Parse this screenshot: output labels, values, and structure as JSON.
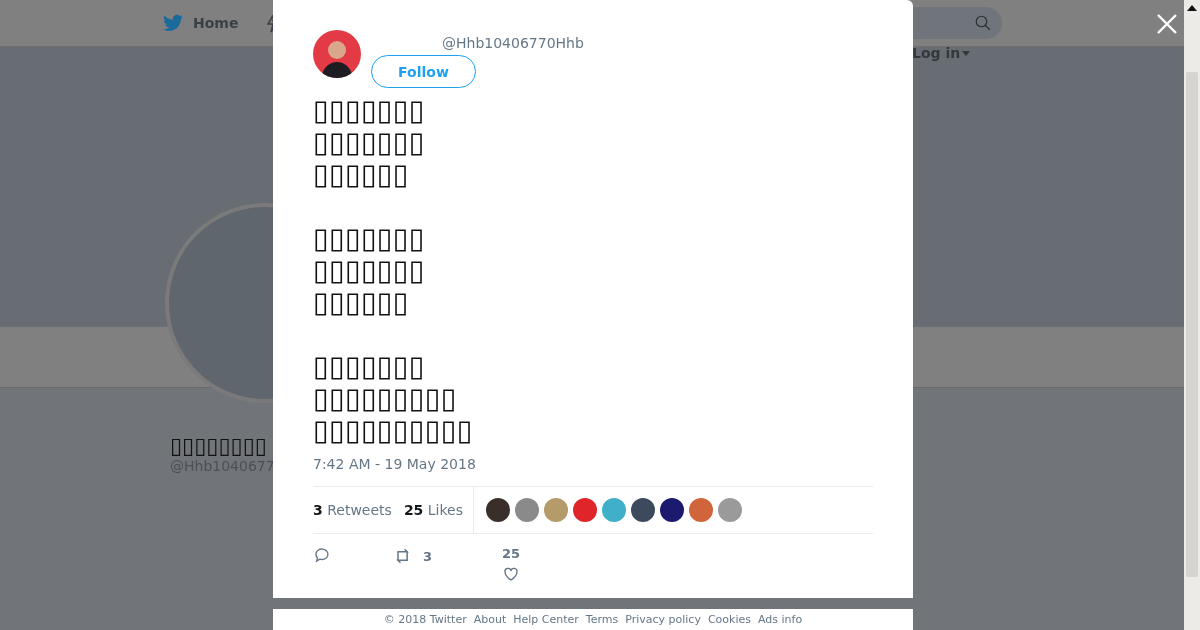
{
  "nav": {
    "home": "Home",
    "login": "Log in"
  },
  "profile": {
    "name": "▯▯▯▯▯▯▯▯",
    "handle": "@Hhb1040677"
  },
  "tweet": {
    "handle": "@Hhb10406770Hhb",
    "follow": "Follow",
    "paragraphs": [
      [
        "▯▯▯▯▯▯▯",
        "▯▯▯▯▯▯▯",
        "▯▯▯▯▯▯"
      ],
      [
        "▯▯▯▯▯▯▯",
        "▯▯▯▯▯▯▯",
        "▯▯▯▯▯▯"
      ],
      [
        "▯▯▯▯▯▯▯",
        "▯▯▯▯▯▯▯▯▯",
        "▯▯▯▯▯▯▯▯▯▯"
      ]
    ],
    "time": "7:42 AM - 19 May 2018",
    "stats": [
      {
        "count": "3",
        "label": "Retweets"
      },
      {
        "count": "25",
        "label": "Likes"
      }
    ],
    "likers": [
      {
        "color": "#3a2e2a"
      },
      {
        "color": "#8a8a8a"
      },
      {
        "color": "#b59a6a"
      },
      {
        "color": "#e0252a"
      },
      {
        "color": "#3fb0c8"
      },
      {
        "color": "#3d4a5e"
      },
      {
        "color": "#1c1a6e"
      },
      {
        "color": "#d0643a"
      },
      {
        "color": "#9a9a9a"
      }
    ],
    "actions": {
      "retweets": "3",
      "likes": "25"
    }
  },
  "footer": "© 2018 Twitter  About  Help Center  Terms  Privacy policy  Cookies  Ads info"
}
